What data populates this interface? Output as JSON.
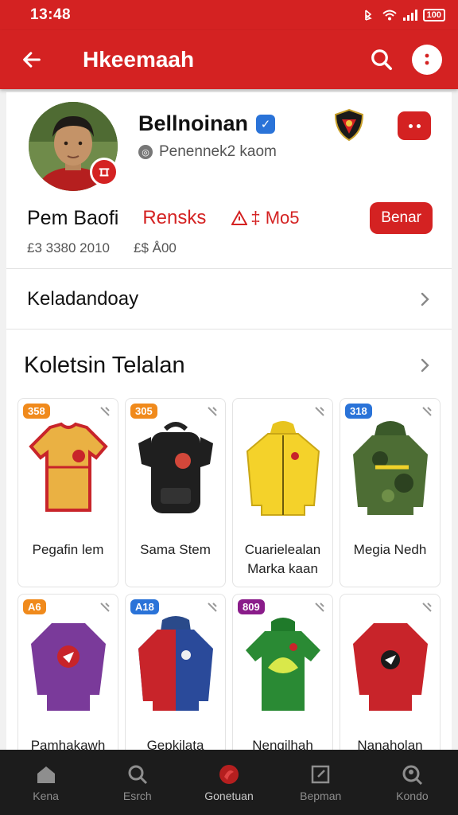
{
  "status_bar": {
    "time": "13:48",
    "battery": "100"
  },
  "app_bar": {
    "title": "Hkeemaah"
  },
  "profile": {
    "username": "Bellnoinan",
    "handle": "Penennek2 kaom",
    "name": "Pem Baofi",
    "rank_label": "Rensks",
    "rank_value": "‡ Mo5",
    "follow_label": "Benar",
    "meta_left": "£3 3380 2010",
    "meta_right": "£$ Å00"
  },
  "sections": {
    "first_label": "Keladandoay",
    "collection_title": "Koletsin Telalan"
  },
  "items": [
    {
      "badge": "358",
      "badge_color": "#f08a1c",
      "name": "Pegafin lem",
      "art": "jersey-yellow"
    },
    {
      "badge": "305",
      "badge_color": "#f08a1c",
      "name": "Sama Stem",
      "art": "backpack-black"
    },
    {
      "badge": "",
      "badge_color": "",
      "name": "Cuarielealan Marka kaan",
      "art": "jacket-yellow"
    },
    {
      "badge": "318",
      "badge_color": "#2a73d8",
      "name": "Megia Nedh",
      "art": "hoodie-camo"
    },
    {
      "badge": "A6",
      "badge_color": "#f08a1c",
      "name": "Pamhakawh",
      "art": "sweater-purple"
    },
    {
      "badge": "A18",
      "badge_color": "#2a73d8",
      "name": "Gepkilata",
      "art": "hoodie-blue-red"
    },
    {
      "badge": "809",
      "badge_color": "#8a1c8a",
      "name": "Nengilhah",
      "art": "jersey-green"
    },
    {
      "badge": "",
      "badge_color": "",
      "name": "Nanaholan",
      "art": "sweater-red"
    }
  ],
  "bottom_nav": [
    {
      "label": "Kena",
      "icon": "home-icon"
    },
    {
      "label": "Esrch",
      "icon": "search-icon"
    },
    {
      "label": "Gonetuan",
      "icon": "club-icon"
    },
    {
      "label": "Bepman",
      "icon": "edit-icon"
    },
    {
      "label": "Kondo",
      "icon": "profile-search-icon"
    }
  ],
  "colors": {
    "primary": "#d42222",
    "nav_bg": "#1c1c1c"
  }
}
